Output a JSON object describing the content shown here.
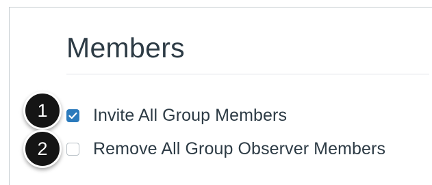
{
  "section": {
    "title": "Members"
  },
  "options": [
    {
      "label": "Invite All Group Members",
      "checked": true
    },
    {
      "label": "Remove All Group Observer Members",
      "checked": false
    }
  ],
  "callouts": [
    {
      "number": "1"
    },
    {
      "number": "2"
    }
  ],
  "colors": {
    "accent": "#2b7abc",
    "text": "#2d3b45",
    "callout_bg": "#151515"
  }
}
